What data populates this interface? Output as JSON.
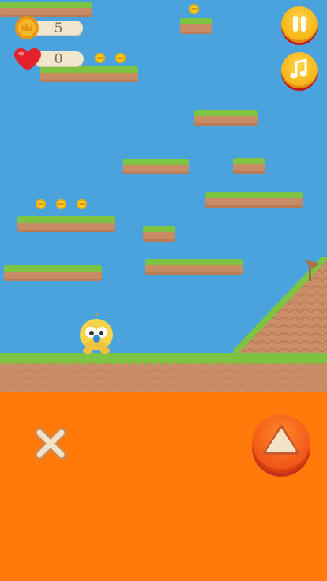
{
  "hud": {
    "coins": "5",
    "lives": "0"
  },
  "controls": {
    "pause_icon": "pause-icon",
    "music_icon": "music-note-icon",
    "jump_icon": "triangle-up-icon",
    "close_icon": "x-icon"
  },
  "colors": {
    "sky": "#4aa3dd",
    "grass": "#7cc442",
    "dirt": "#c98e67",
    "lava": "#ff7a0a",
    "coin": "#f7d11e",
    "player": "#f6d34a",
    "button_yellow": "#f7b81c",
    "button_orange": "#f35a1a"
  }
}
